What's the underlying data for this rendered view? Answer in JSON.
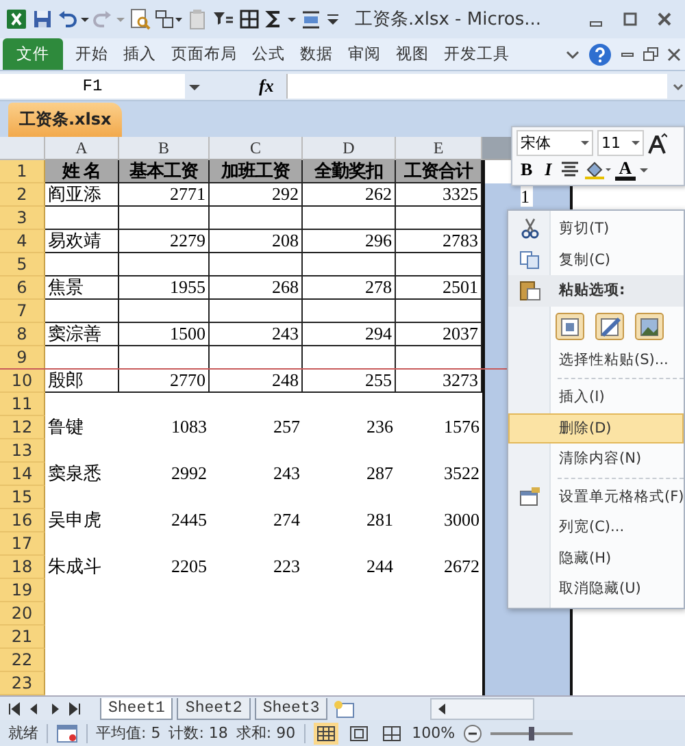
{
  "window": {
    "title": "工资条.xlsx - Micros..."
  },
  "ribbon_tabs": [
    {
      "label": "文件",
      "kind": "file"
    },
    {
      "label": "开始",
      "kind": "tab"
    },
    {
      "label": "插入",
      "kind": "tab"
    },
    {
      "label": "页面布局",
      "kind": "tab"
    },
    {
      "label": "公式",
      "kind": "tab"
    },
    {
      "label": "数据",
      "kind": "tab"
    },
    {
      "label": "审阅",
      "kind": "tab"
    },
    {
      "label": "视图",
      "kind": "tab"
    },
    {
      "label": "开发工具",
      "kind": "tab"
    }
  ],
  "formula_bar": {
    "name_box": "F1",
    "fx": "fx"
  },
  "workbook_tab": "工资条.xlsx",
  "columns": [
    {
      "label": "A",
      "selected": false
    },
    {
      "label": "B",
      "selected": false
    },
    {
      "label": "C",
      "selected": false
    },
    {
      "label": "D",
      "selected": false
    },
    {
      "label": "E",
      "selected": false
    },
    {
      "selected": true
    }
  ],
  "bordered_rows": [
    {
      "number": "1",
      "kind": "header",
      "cells": [
        "姓 名",
        "基本工资",
        "加班工资",
        "全勤奖扣",
        "工资合计"
      ]
    },
    {
      "number": "2",
      "kind": "data",
      "cells": [
        "阎亚添",
        "2771",
        "292",
        "262",
        "3325"
      ],
      "column_6_text": "1"
    },
    {
      "number": "3",
      "kind": "blank"
    },
    {
      "number": "4",
      "kind": "data",
      "cells": [
        "易欢靖",
        "2279",
        "208",
        "296",
        "2783"
      ]
    },
    {
      "number": "5",
      "kind": "blank"
    },
    {
      "number": "6",
      "kind": "data",
      "cells": [
        "焦景",
        "1955",
        "268",
        "278",
        "2501"
      ]
    },
    {
      "number": "7",
      "kind": "blank"
    },
    {
      "number": "8",
      "kind": "data",
      "cells": [
        "窦淙善",
        "1500",
        "243",
        "294",
        "2037"
      ]
    },
    {
      "number": "9",
      "kind": "blank"
    },
    {
      "number": "10",
      "kind": "data",
      "cells": [
        "殷郎",
        "2770",
        "248",
        "255",
        "3273"
      ]
    }
  ],
  "plain_rows": [
    {
      "number": "11",
      "kind": "blank"
    },
    {
      "number": "12",
      "kind": "data",
      "cells": [
        "鲁键",
        "1083",
        "257",
        "236",
        "1576"
      ]
    },
    {
      "number": "13",
      "kind": "blank"
    },
    {
      "number": "14",
      "kind": "data",
      "cells": [
        "窦泉悉",
        "2992",
        "243",
        "287",
        "3522"
      ]
    },
    {
      "number": "15",
      "kind": "blank"
    },
    {
      "number": "16",
      "kind": "data",
      "cells": [
        "吴申虎",
        "2445",
        "274",
        "281",
        "3000"
      ]
    },
    {
      "number": "17",
      "kind": "blank"
    },
    {
      "number": "18",
      "kind": "data",
      "cells": [
        "朱成斗",
        "2205",
        "223",
        "244",
        "2672"
      ]
    },
    {
      "number": "19",
      "kind": "blank"
    },
    {
      "number": "20",
      "kind": "blank"
    },
    {
      "number": "21",
      "kind": "blank"
    },
    {
      "number": "22",
      "kind": "blank"
    },
    {
      "number": "23",
      "kind": "blank"
    }
  ],
  "mini_toolbar": {
    "font": "宋体",
    "size": "11",
    "bold": "B",
    "italic": "I",
    "font_color": "A"
  },
  "context_menu": [
    {
      "label": "剪切(T)",
      "kind": "cut",
      "selected": false,
      "divider_above": false
    },
    {
      "label": "复制(C)",
      "kind": "copy",
      "selected": false,
      "divider_above": false
    },
    {
      "label": "粘贴选项:",
      "kind": "paste",
      "selected": false,
      "divider_above": false
    },
    {
      "kind": "paste_options"
    },
    {
      "label": "选择性粘贴(S)...",
      "kind": "plain",
      "selected": false,
      "divider_above": false
    },
    {
      "label": "插入(I)",
      "kind": "plain",
      "selected": false,
      "divider_above": true
    },
    {
      "label": "删除(D)",
      "kind": "plain",
      "selected": true,
      "divider_above": false
    },
    {
      "label": "清除内容(N)",
      "kind": "plain",
      "selected": false,
      "divider_above": false
    },
    {
      "label": "设置单元格格式(F)",
      "kind": "format",
      "selected": false,
      "divider_above": true
    },
    {
      "label": "列宽(C)...",
      "kind": "plain",
      "selected": false,
      "divider_above": false
    },
    {
      "label": "隐藏(H)",
      "kind": "plain",
      "selected": false,
      "divider_above": false
    },
    {
      "label": "取消隐藏(U)",
      "kind": "plain",
      "selected": false,
      "divider_above": false
    }
  ],
  "sheet_tabs": [
    {
      "label": "Sheet1",
      "selected": true
    },
    {
      "label": "Sheet2",
      "selected": false
    },
    {
      "label": "Sheet3",
      "selected": false
    }
  ],
  "status_bar": {
    "ready": "就绪",
    "average": "平均值: 5",
    "count": "计数: 18",
    "sum": "求和: 90",
    "zoom": "100%",
    "zoom_slider": {
      "level": 0.5
    }
  }
}
